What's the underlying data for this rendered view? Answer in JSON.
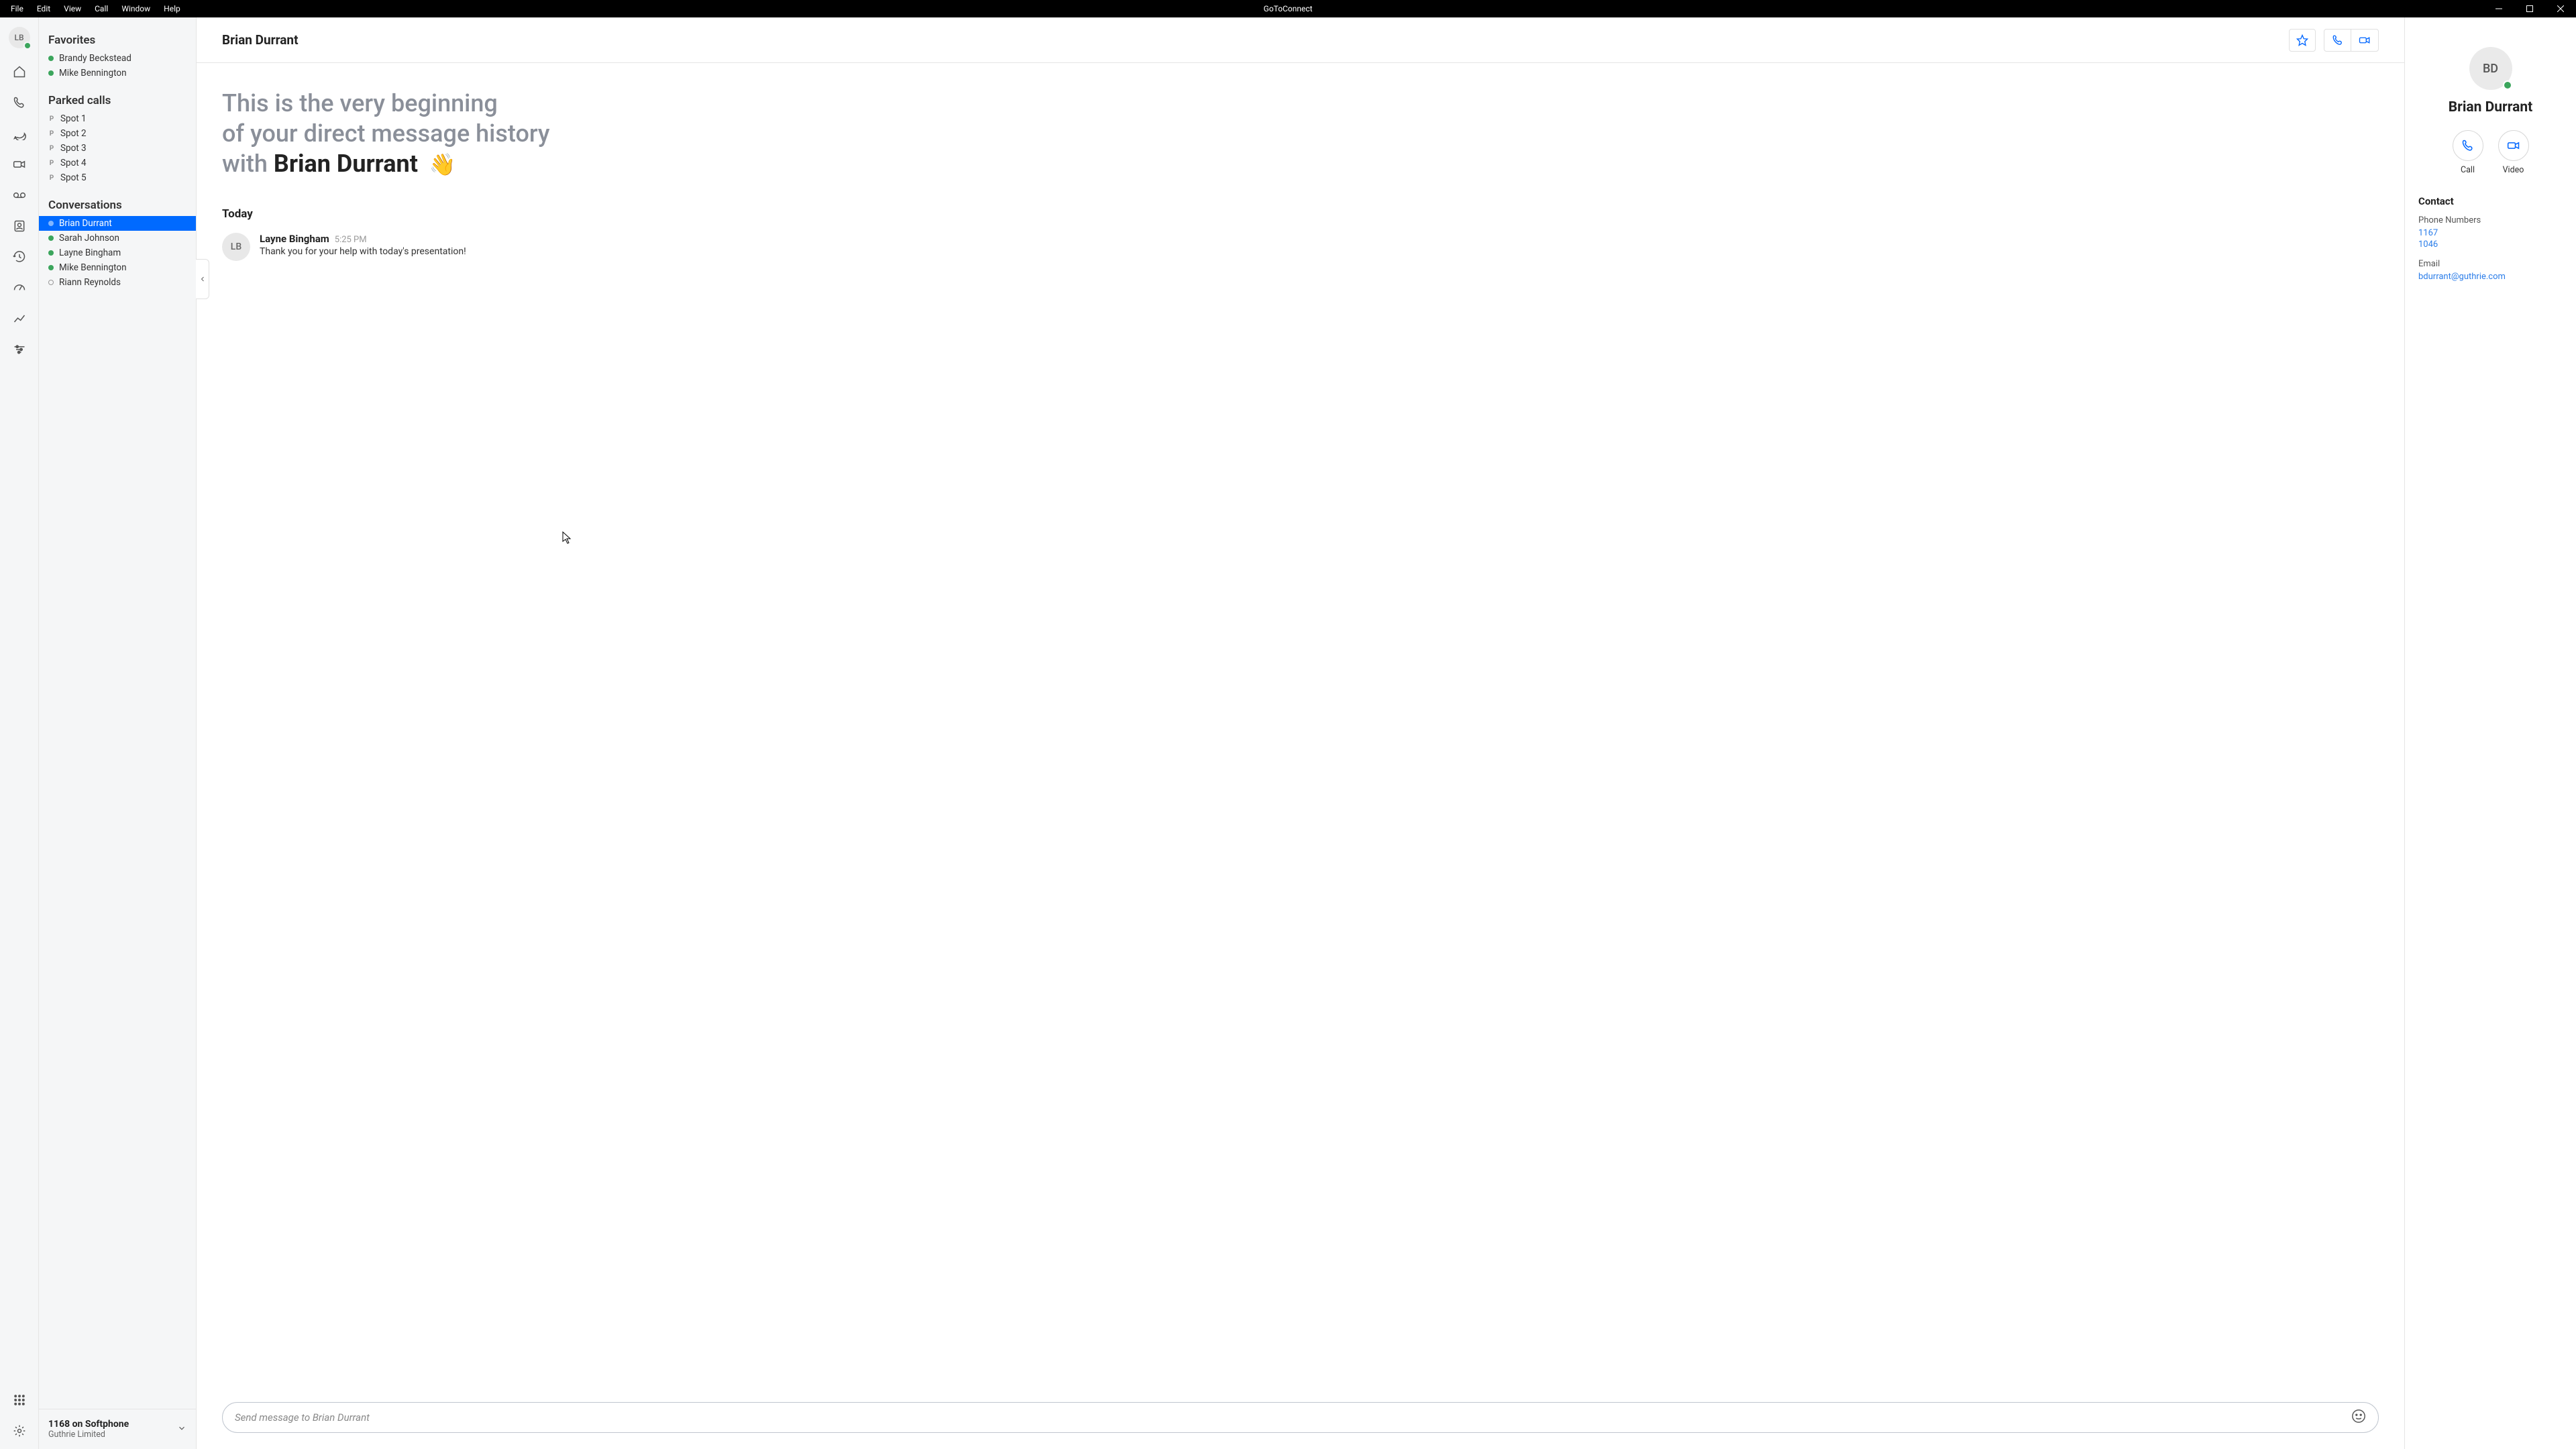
{
  "titlebar": {
    "menus": [
      "File",
      "Edit",
      "View",
      "Call",
      "Window",
      "Help"
    ],
    "app_title": "GoToConnect"
  },
  "rail": {
    "user_initials": "LB"
  },
  "sidebar": {
    "favorites_header": "Favorites",
    "favorites": [
      {
        "name": "Brandy Beckstead",
        "online": true
      },
      {
        "name": "Mike Bennington",
        "online": true
      }
    ],
    "parked_header": "Parked calls",
    "parked": [
      "Spot 1",
      "Spot 2",
      "Spot 3",
      "Spot 4",
      "Spot 5"
    ],
    "conversations_header": "Conversations",
    "conversations": [
      {
        "name": "Brian Durrant",
        "online": true,
        "selected": true
      },
      {
        "name": "Sarah Johnson",
        "online": true
      },
      {
        "name": "Layne Bingham",
        "online": true
      },
      {
        "name": "Mike Bennington",
        "online": true
      },
      {
        "name": "Riann Reynolds",
        "online": false
      }
    ],
    "footer": {
      "line1": "1168 on Softphone",
      "line2": "Guthrie Limited"
    }
  },
  "chat": {
    "header_title": "Brian Durrant",
    "intro_line1": "This is the very beginning",
    "intro_line2": "of your direct message history",
    "intro_line3_prefix": "with ",
    "intro_name": "Brian Durrant",
    "wave": "👋",
    "date_label": "Today",
    "messages": [
      {
        "avatar": "LB",
        "sender": "Layne Bingham",
        "time": "5:25 PM",
        "text": "Thank you for your help with today's presentation!"
      }
    ],
    "composer_placeholder": "Send message to Brian Durrant"
  },
  "details": {
    "avatar_initials": "BD",
    "name": "Brian Durrant",
    "call_label": "Call",
    "video_label": "Video",
    "contact_header": "Contact",
    "phone_label": "Phone Numbers",
    "phones": [
      "1167",
      "1046"
    ],
    "email_label": "Email",
    "email": "bdurrant@guthrie.com"
  }
}
